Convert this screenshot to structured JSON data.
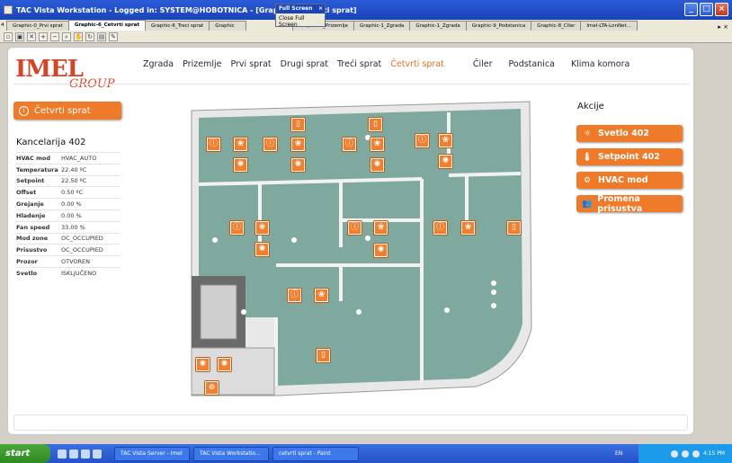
{
  "window": {
    "title": "TAC Vista Workstation - Logged in: SYSTEM@HOBOTNICA - [Graphic-6_Cetvrti sprat]"
  },
  "fullscreen_popup": {
    "title": "Full Screen",
    "close_label": "Close Full Screen"
  },
  "tabs": [
    {
      "label": "Graphic-0_Prvi sprat"
    },
    {
      "label": "Graphic-6_Cetvrti sprat"
    },
    {
      "label": "Graphic-6_Treci sprat"
    },
    {
      "label": "Graphic"
    },
    {
      "label": "Graphic-3_Prizemlje"
    },
    {
      "label": "Graphic-1_Zgrada"
    },
    {
      "label": "Graphic-1_Zgrada"
    },
    {
      "label": "Graphic-9_Podstanica"
    },
    {
      "label": "Graphic-8_Cller"
    },
    {
      "label": "Imel-LTA-LonNet..."
    }
  ],
  "nav": {
    "items": [
      "Zgrada",
      "Prizemlje",
      "Prvi sprat",
      "Drugi sprat",
      "Treći sprat",
      "Četvrti sprat",
      "Čiler",
      "Podstanica",
      "Klima komora"
    ]
  },
  "left": {
    "floor_button": "Četvrti sprat",
    "room_title": "Kancelarija 402",
    "props": [
      {
        "k": "HVAC mod",
        "v": "HVAC_AUTO"
      },
      {
        "k": "Temperatura",
        "v": "22.40 ºC"
      },
      {
        "k": "Setpoint",
        "v": "22.50 ºC"
      },
      {
        "k": "Offset",
        "v": "0.50 ºC"
      },
      {
        "k": "Grejanje",
        "v": "0.00 %"
      },
      {
        "k": "Hladenje",
        "v": "0.00 %"
      },
      {
        "k": "Fan speed",
        "v": "33.00 %"
      },
      {
        "k": "Mod zone",
        "v": "OC_OCCUPIED"
      },
      {
        "k": "Prisustvo",
        "v": "OC_OCCUPIED"
      },
      {
        "k": "Prozor",
        "v": "OTVOREN"
      },
      {
        "k": "Svetlo",
        "v": "ISKLJUČENO"
      }
    ]
  },
  "right": {
    "title": "Akcije",
    "actions": [
      {
        "label": "Svetlo 402",
        "icon": "light-icon"
      },
      {
        "label": "Setpoint 402",
        "icon": "thermometer-icon"
      },
      {
        "label": "HVAC mod",
        "icon": "gears-icon"
      },
      {
        "label": "Promena prisustva",
        "icon": "people-icon"
      }
    ]
  },
  "taskbar": {
    "start": "start",
    "items": [
      "TAC Vista Server - Imel",
      "TAC Vista Workstatio...",
      "cetvrti sprat - Paint"
    ],
    "lang": "EN",
    "clock": "4:15 PM"
  },
  "colors": {
    "accent": "#ee7a2a",
    "floor": "#7fa89e",
    "logo": "#d2452a"
  }
}
